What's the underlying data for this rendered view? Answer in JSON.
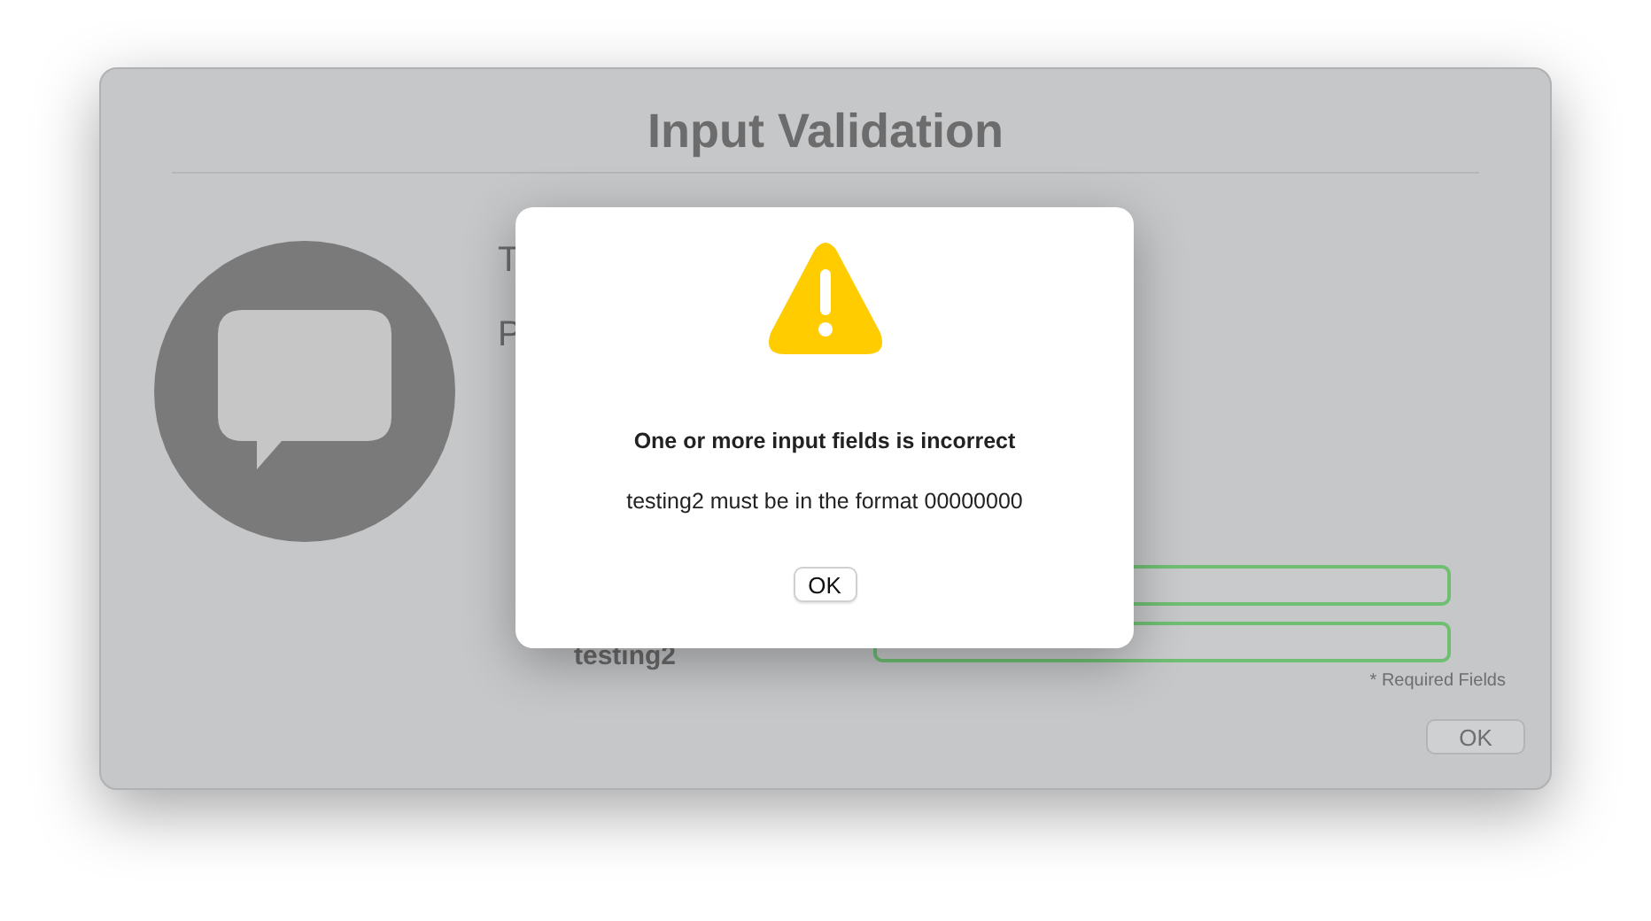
{
  "window": {
    "title": "Input Validation"
  },
  "form": {
    "partial_labels": [
      "T",
      "P"
    ],
    "fields": [
      {
        "kind": "unlabelled"
      },
      {
        "kind": "labelled",
        "label": "testing2"
      }
    ],
    "required_note": "* Required Fields",
    "ok_button": "OK"
  },
  "alert": {
    "title": "One or more input fields is incorrect",
    "message": "testing2 must be in the format 00000000",
    "button": "OK"
  }
}
